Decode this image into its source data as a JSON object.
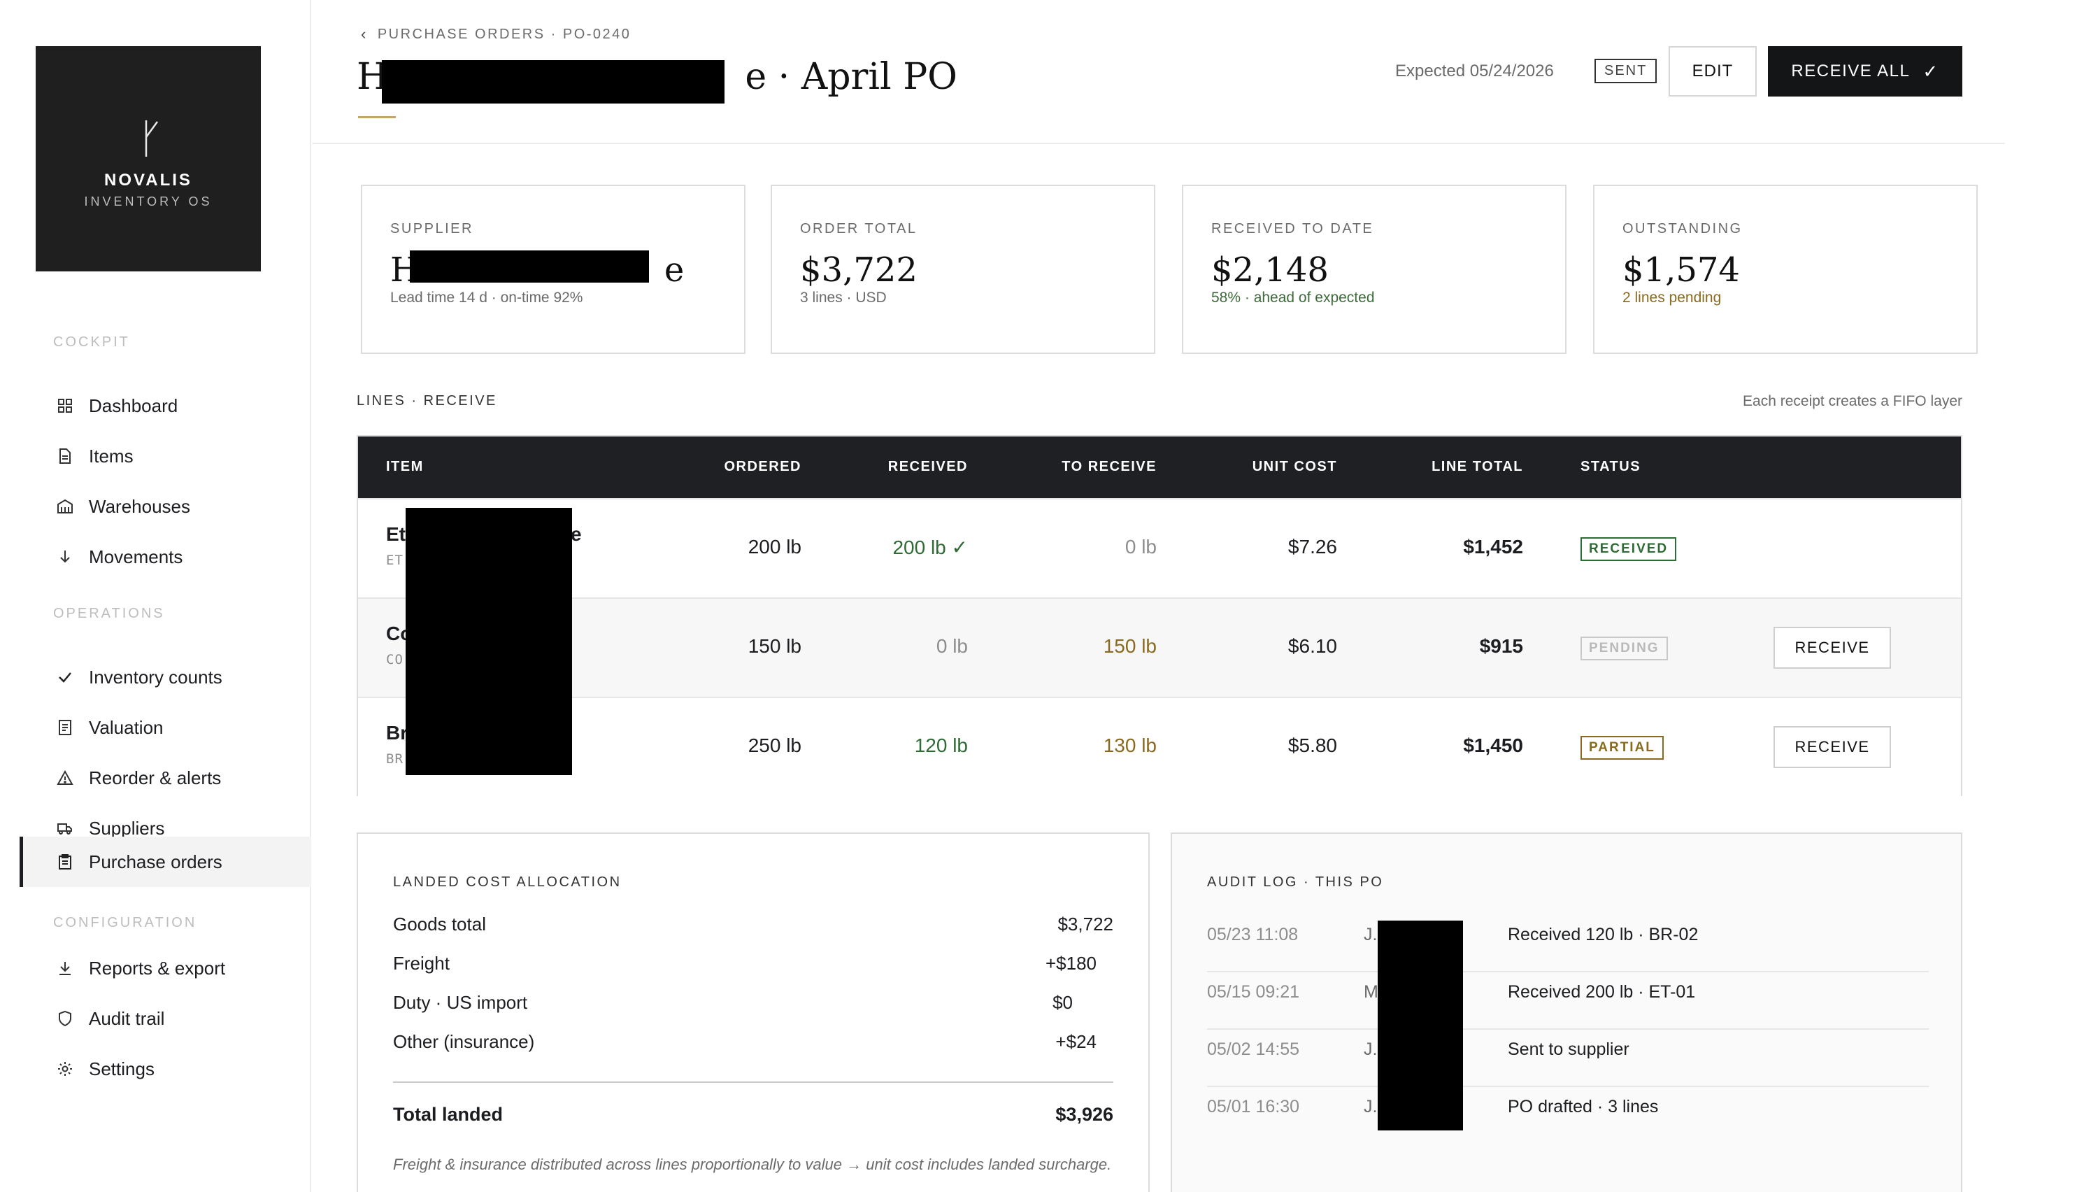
{
  "brand": {
    "name": "NOVALIS",
    "subtitle": "INVENTORY OS"
  },
  "sidebar": {
    "sections": [
      {
        "label": "COCKPIT",
        "items": [
          {
            "label": "Dashboard",
            "icon": "grid-icon"
          },
          {
            "label": "Items",
            "icon": "document-icon"
          },
          {
            "label": "Warehouses",
            "icon": "warehouse-icon"
          },
          {
            "label": "Movements",
            "icon": "arrow-down-icon"
          }
        ]
      },
      {
        "label": "OPERATIONS",
        "items": [
          {
            "label": "Inventory counts",
            "icon": "check-icon"
          },
          {
            "label": "Valuation",
            "icon": "ledger-icon"
          },
          {
            "label": "Reorder & alerts",
            "icon": "alert-triangle-icon"
          },
          {
            "label": "Suppliers",
            "icon": "truck-icon"
          },
          {
            "label": "Purchase orders",
            "icon": "clipboard-icon",
            "active": true
          }
        ]
      },
      {
        "label": "CONFIGURATION",
        "items": [
          {
            "label": "Reports & export",
            "icon": "download-icon"
          },
          {
            "label": "Audit trail",
            "icon": "shield-icon"
          },
          {
            "label": "Settings",
            "icon": "gear-icon"
          }
        ]
      }
    ]
  },
  "header": {
    "breadcrumb": "PURCHASE ORDERS · PO-0240",
    "title_prefix": "H",
    "title_suffix": "e · April PO",
    "expected": "Expected 05/24/2026",
    "status_badge": "SENT",
    "edit_label": "EDIT",
    "receive_all_label": "RECEIVE ALL"
  },
  "cards": [
    {
      "label": "SUPPLIER",
      "value_prefix": "H",
      "value_suffix": "e",
      "sub": "Lead time 14 d · on-time 92%"
    },
    {
      "label": "ORDER TOTAL",
      "value": "$3,722",
      "sub": "3 lines · USD"
    },
    {
      "label": "RECEIVED TO DATE",
      "value": "$2,148",
      "sub": "58% · ahead of expected"
    },
    {
      "label": "OUTSTANDING",
      "value": "$1,574",
      "sub": "2 lines pending"
    }
  ],
  "lines": {
    "section_label": "LINES · RECEIVE",
    "note": "Each receipt creates a FIFO layer",
    "columns": [
      "ITEM",
      "ORDERED",
      "RECEIVED",
      "TO RECEIVE",
      "UNIT COST",
      "LINE TOTAL",
      "STATUS"
    ],
    "rows": [
      {
        "name": "Et",
        "name_tail": "e",
        "sku": "ET",
        "ordered": "200 lb",
        "received": "200 lb ✓",
        "to_receive": "0 lb",
        "unit_cost": "$7.26",
        "line_total": "$1,452",
        "status": "RECEIVED",
        "action": ""
      },
      {
        "name": "Co",
        "name_tail": "",
        "sku": "CO",
        "ordered": "150 lb",
        "received": "0 lb",
        "to_receive": "150 lb",
        "unit_cost": "$6.10",
        "line_total": "$915",
        "status": "PENDING",
        "action": "RECEIVE"
      },
      {
        "name": "Br",
        "name_tail": "",
        "sku": "BR",
        "ordered": "250 lb",
        "received": "120 lb",
        "to_receive": "130 lb",
        "unit_cost": "$5.80",
        "line_total": "$1,450",
        "status": "PARTIAL",
        "action": "RECEIVE"
      }
    ]
  },
  "landed_cost": {
    "title": "LANDED COST ALLOCATION",
    "rows": [
      {
        "label": "Goods total",
        "value": "$3,722"
      },
      {
        "label": "Freight",
        "value": "+$180"
      },
      {
        "label": "Duty · US import",
        "value": "$0"
      },
      {
        "label": "Other (insurance)",
        "value": "+$24"
      }
    ],
    "total_label": "Total landed",
    "total_value": "$3,926",
    "note": "Freight & insurance distributed across lines proportionally to value → unit cost includes landed surcharge."
  },
  "audit": {
    "title": "AUDIT LOG · THIS PO",
    "entries": [
      {
        "time": "05/23 11:08",
        "who": "J.",
        "text": "Received 120 lb · BR-02"
      },
      {
        "time": "05/15 09:21",
        "who": "M",
        "text": "Received 200 lb · ET-01"
      },
      {
        "time": "05/02 14:55",
        "who": "J.",
        "text": "Sent to supplier"
      },
      {
        "time": "05/01 16:30",
        "who": "J.",
        "text": "PO drafted · 3 lines"
      }
    ]
  },
  "colors": {
    "accent": "#c9a46a",
    "dark": "#1f2024",
    "green": "#2f6b35",
    "amber": "#8a6a1e"
  }
}
